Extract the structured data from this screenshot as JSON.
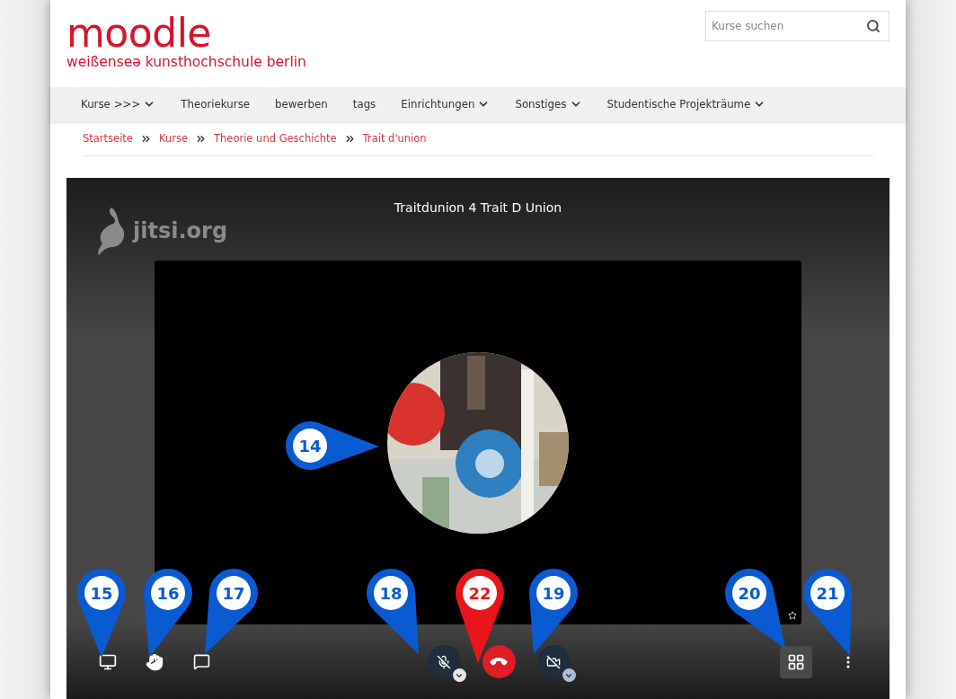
{
  "header": {
    "logo": "moodle",
    "subtitle": "weißenseə kunsthochschule berlin",
    "search": {
      "placeholder": "Kurse suchen"
    }
  },
  "nav": [
    {
      "label": "Kurse >>>",
      "has_menu": true
    },
    {
      "label": "Theoriekurse",
      "has_menu": false
    },
    {
      "label": "bewerben",
      "has_menu": false
    },
    {
      "label": "tags",
      "has_menu": false
    },
    {
      "label": "Einrichtungen",
      "has_menu": true
    },
    {
      "label": "Sonstiges",
      "has_menu": true
    },
    {
      "label": "Studentische Projekträume",
      "has_menu": true
    }
  ],
  "breadcrumb": [
    "Startseite",
    "Kurse",
    "Theorie und Geschichte",
    "Trait d'union"
  ],
  "meeting": {
    "title": "Traitdunion 4 Trait D Union",
    "brand": "jitsi.org",
    "toolbar": {
      "mic_muted": true,
      "camera_off": true,
      "tile_view": {
        "selected": true
      }
    }
  },
  "callouts": [
    {
      "number": "14",
      "color": "#0a5bd1"
    },
    {
      "number": "15",
      "color": "#0a5bd1"
    },
    {
      "number": "16",
      "color": "#0a5bd1"
    },
    {
      "number": "17",
      "color": "#0a5bd1"
    },
    {
      "number": "18",
      "color": "#0a5bd1"
    },
    {
      "number": "22",
      "color": "#e8151b"
    },
    {
      "number": "19",
      "color": "#0a5bd1"
    },
    {
      "number": "20",
      "color": "#0a5bd1"
    },
    {
      "number": "21",
      "color": "#0a5bd1"
    }
  ]
}
